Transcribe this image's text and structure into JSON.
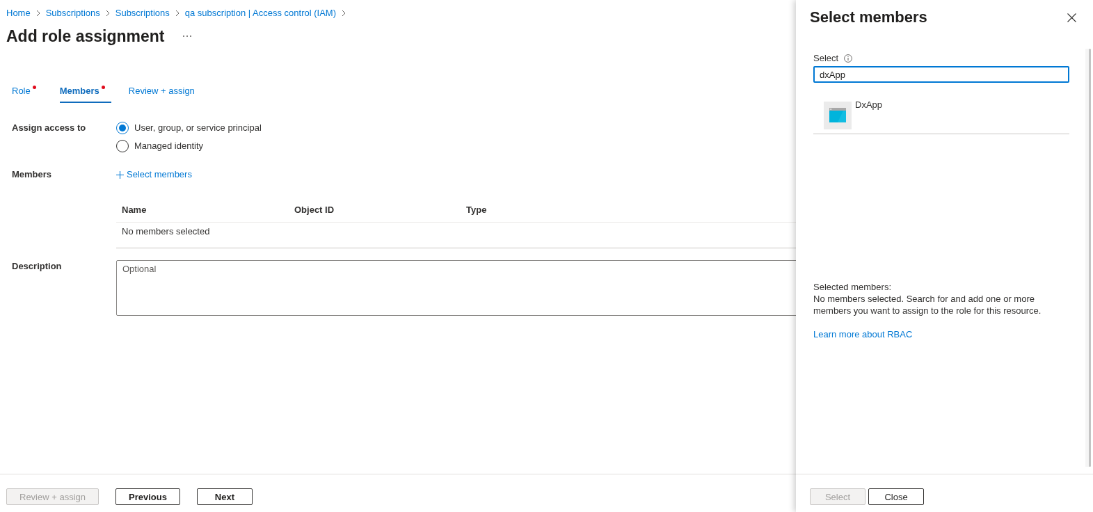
{
  "breadcrumb": [
    {
      "label": "Home"
    },
    {
      "label": "Subscriptions"
    },
    {
      "label": "Subscriptions"
    },
    {
      "label": "qa subscription | Access control (IAM)"
    }
  ],
  "page": {
    "title": "Add role assignment"
  },
  "tabs": [
    {
      "label": "Role",
      "selected": false,
      "required": true
    },
    {
      "label": "Members",
      "selected": true,
      "required": true
    },
    {
      "label": "Review + assign",
      "selected": false,
      "required": false
    }
  ],
  "form": {
    "assign_access": {
      "label": "Assign access to",
      "options": [
        {
          "label": "User, group, or service principal",
          "selected": true
        },
        {
          "label": "Managed identity",
          "selected": false
        }
      ]
    },
    "members": {
      "label": "Members",
      "add_link": "Select members",
      "table": {
        "columns": [
          "Name",
          "Object ID",
          "Type"
        ],
        "empty_text": "No members selected"
      }
    },
    "description": {
      "label": "Description",
      "placeholder": "Optional"
    }
  },
  "footer": {
    "buttons": [
      {
        "label": "Review + assign",
        "disabled": true
      },
      {
        "label": "Previous",
        "disabled": false
      },
      {
        "label": "Next",
        "disabled": false
      }
    ]
  },
  "panel": {
    "title": "Select members",
    "search": {
      "label": "Select",
      "value": "dxApp"
    },
    "results": [
      {
        "name": "DxApp"
      }
    ],
    "selected_heading": "Selected members:",
    "selected_text": "No members selected. Search for and add one or more members you want to assign to the role for this resource.",
    "link": "Learn more about RBAC",
    "buttons": [
      {
        "label": "Select",
        "disabled": true
      },
      {
        "label": "Close",
        "disabled": false
      }
    ]
  }
}
